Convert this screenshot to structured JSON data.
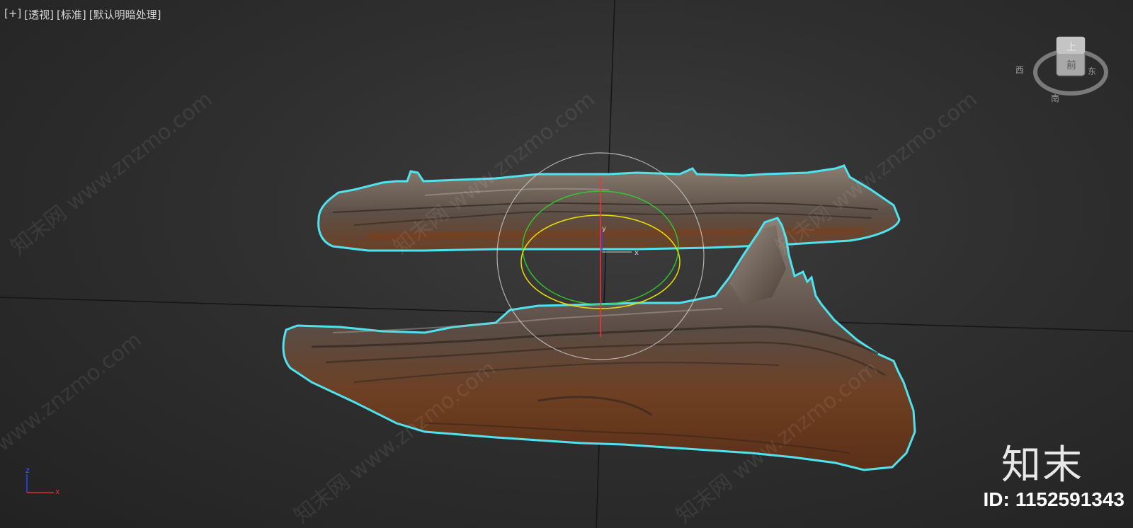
{
  "viewport": {
    "labels": [
      "[+]",
      "[透视]",
      "[标准]",
      "[默认明暗处理]"
    ]
  },
  "viewcube": {
    "top_face": "上",
    "front_face": "前",
    "south": "南",
    "east": "东",
    "west": "西"
  },
  "axis_tripod": {
    "x": "x",
    "z": "z"
  },
  "gizmo_axis": {
    "x": "x",
    "y": "y"
  },
  "watermark": {
    "text": "知末网 www.znzmo.com"
  },
  "brand": {
    "logo_text": "知末",
    "id_label": "ID:",
    "id_value": "1152591343"
  },
  "colors": {
    "selection_outline": "#4fe3f0",
    "gizmo_x": "#ff3030",
    "gizmo_y": "#30d030",
    "gizmo_z": "#3040ff",
    "gizmo_yellow": "#e8e000",
    "gizmo_white": "#d0d0d0"
  }
}
